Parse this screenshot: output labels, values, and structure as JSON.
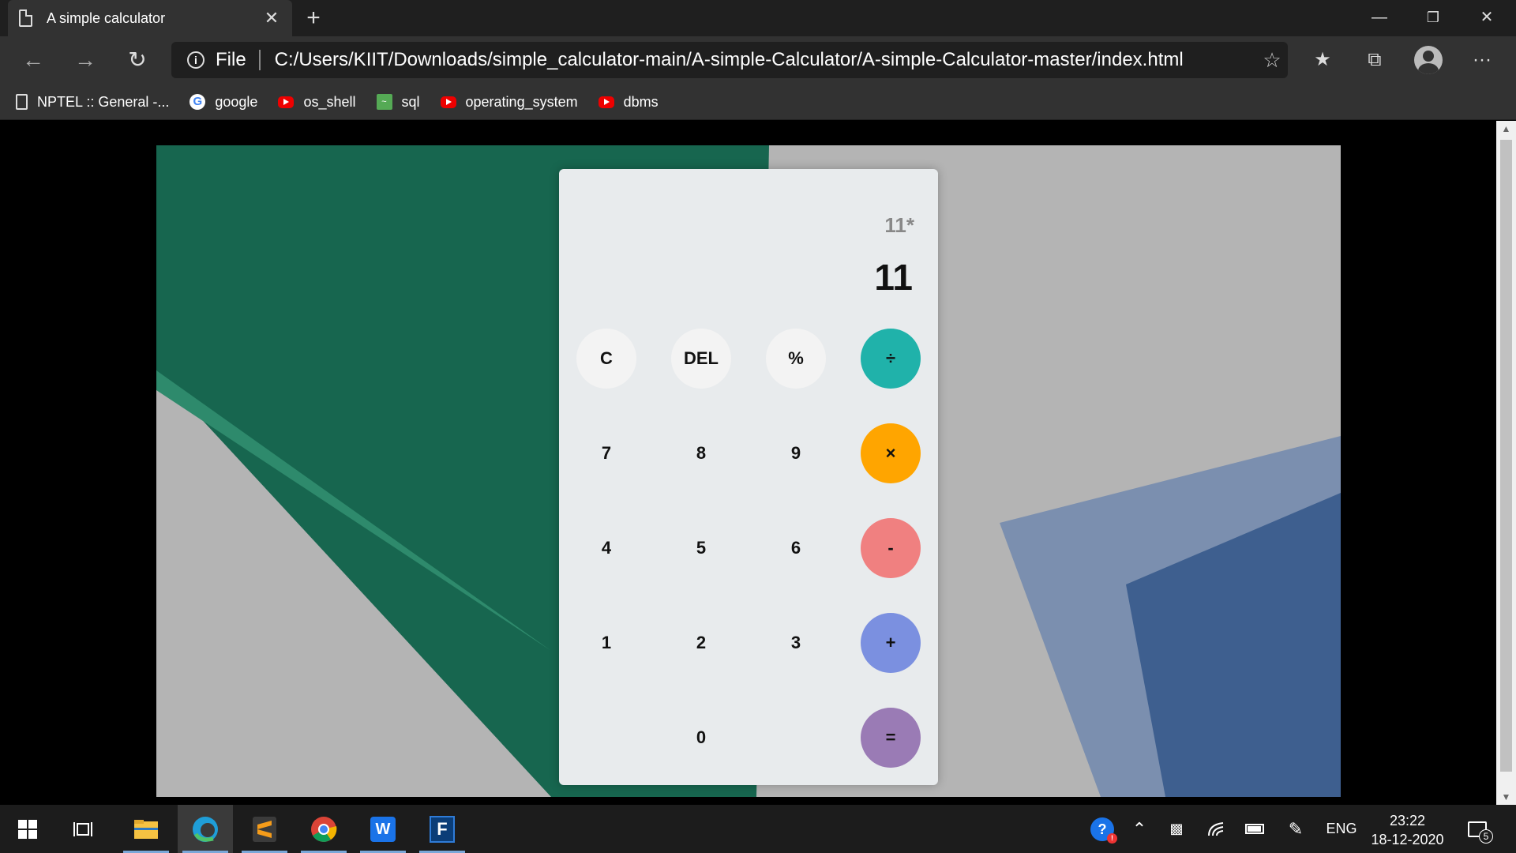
{
  "browser": {
    "tab_title": "A simple calculator",
    "tab_close": "✕",
    "new_tab": "+",
    "window_controls": {
      "minimize": "—",
      "restore": "❐",
      "close": "✕"
    },
    "address": {
      "scheme_label": "File",
      "url": "C:/Users/KIIT/Downloads/simple_calculator-main/A-simple-Calculator/A-simple-Calculator-master/index.html"
    },
    "bookmarks": [
      {
        "label": "NPTEL :: General -...",
        "icon": "document-icon"
      },
      {
        "label": "google",
        "icon": "google-icon"
      },
      {
        "label": "os_shell",
        "icon": "youtube-icon"
      },
      {
        "label": "sql",
        "icon": "sql-icon"
      },
      {
        "label": "operating_system",
        "icon": "youtube-icon"
      },
      {
        "label": "dbms",
        "icon": "youtube-icon"
      }
    ],
    "more_label": "···"
  },
  "calculator": {
    "previous_operand": "11*",
    "current_operand": "11",
    "keys": {
      "clear": "C",
      "delete": "DEL",
      "percent": "%",
      "divide": "÷",
      "seven": "7",
      "eight": "8",
      "nine": "9",
      "multiply": "×",
      "four": "4",
      "five": "5",
      "six": "6",
      "subtract": "-",
      "one": "1",
      "two": "2",
      "three": "3",
      "add": "+",
      "zero": "0",
      "equals": "="
    },
    "colors": {
      "divide": "#20b2aa",
      "multiply": "#ffa500",
      "subtract": "#f08080",
      "add": "#7b90e0",
      "equals": "#9a7bb5",
      "function_key": "#f3f3f3",
      "panel": "#e8ebed"
    }
  },
  "background_colors": {
    "green": "#17664f",
    "green_light": "#2e8a6c",
    "gray": "#b4b4b4",
    "blue_light": "#7b8faf",
    "blue_dark": "#3e5f8f"
  },
  "taskbar": {
    "apps": [
      "start-icon",
      "task-view-icon",
      "file-explorer-icon",
      "edge-icon",
      "sublime-text-icon",
      "chrome-icon",
      "word-icon",
      "fortran-icon"
    ],
    "fortran_label": "F",
    "word_label": "W",
    "language": "ENG",
    "time": "23:22",
    "date": "18-12-2020",
    "notification_count": "5"
  }
}
